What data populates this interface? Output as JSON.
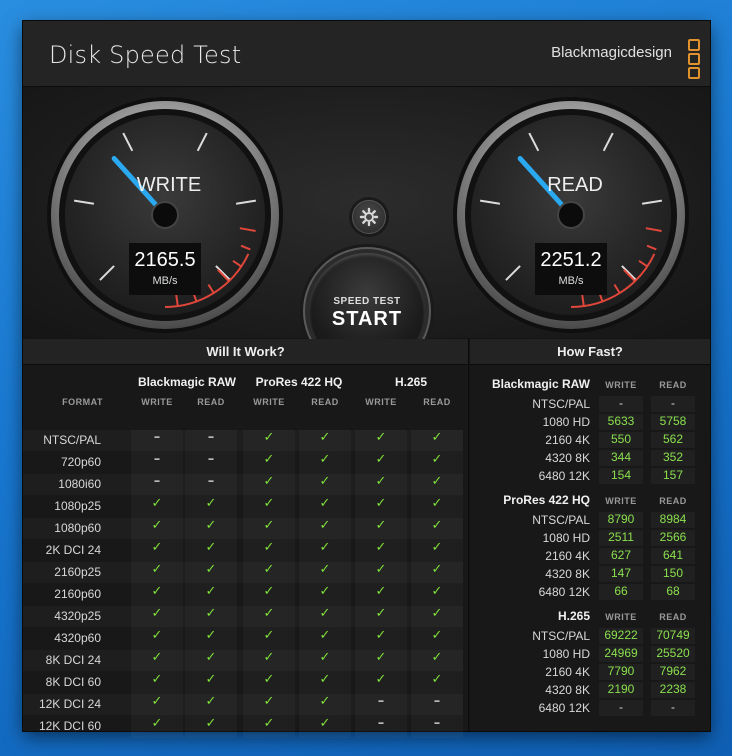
{
  "window": {
    "title": "Disk Speed Test",
    "brand": "Blackmagicdesign",
    "close_label": "✕"
  },
  "gauges": {
    "write": {
      "label": "WRITE",
      "value": "2165.5",
      "unit": "MB/s"
    },
    "read": {
      "label": "READ",
      "value": "2251.2",
      "unit": "MB/s"
    }
  },
  "start_button": {
    "line1": "SPEED TEST",
    "line2": "START"
  },
  "settings_icon": "gear-icon",
  "colors": {
    "accent_green": "#7fe03a",
    "logo_orange": "#e0922c",
    "needle": "#2aa8f0",
    "redline": "#e0473a"
  },
  "will_it_work": {
    "title": "Will It Work?",
    "format_label": "FORMAT",
    "groups": [
      {
        "name": "Blackmagic RAW",
        "write": "WRITE",
        "read": "READ"
      },
      {
        "name": "ProRes 422 HQ",
        "write": "WRITE",
        "read": "READ"
      },
      {
        "name": "H.265",
        "write": "WRITE",
        "read": "READ"
      }
    ],
    "yes_symbol": "✓",
    "no_symbol": "–",
    "rows": [
      {
        "format": "NTSC/PAL",
        "cells": [
          0,
          0,
          1,
          1,
          1,
          1
        ]
      },
      {
        "format": "720p60",
        "cells": [
          0,
          0,
          1,
          1,
          1,
          1
        ]
      },
      {
        "format": "1080i60",
        "cells": [
          0,
          0,
          1,
          1,
          1,
          1
        ]
      },
      {
        "format": "1080p25",
        "cells": [
          1,
          1,
          1,
          1,
          1,
          1
        ]
      },
      {
        "format": "1080p60",
        "cells": [
          1,
          1,
          1,
          1,
          1,
          1
        ]
      },
      {
        "format": "2K DCI 24",
        "cells": [
          1,
          1,
          1,
          1,
          1,
          1
        ]
      },
      {
        "format": "2160p25",
        "cells": [
          1,
          1,
          1,
          1,
          1,
          1
        ]
      },
      {
        "format": "2160p60",
        "cells": [
          1,
          1,
          1,
          1,
          1,
          1
        ]
      },
      {
        "format": "4320p25",
        "cells": [
          1,
          1,
          1,
          1,
          1,
          1
        ]
      },
      {
        "format": "4320p60",
        "cells": [
          1,
          1,
          1,
          1,
          1,
          1
        ]
      },
      {
        "format": "8K DCI 24",
        "cells": [
          1,
          1,
          1,
          1,
          1,
          1
        ]
      },
      {
        "format": "8K DCI 60",
        "cells": [
          1,
          1,
          1,
          1,
          1,
          1
        ]
      },
      {
        "format": "12K DCI 24",
        "cells": [
          1,
          1,
          1,
          1,
          0,
          0
        ]
      },
      {
        "format": "12K DCI 60",
        "cells": [
          1,
          1,
          1,
          1,
          0,
          0
        ]
      }
    ]
  },
  "how_fast": {
    "title": "How Fast?",
    "sections": [
      {
        "name": "Blackmagic RAW",
        "write": "WRITE",
        "read": "READ",
        "rows": [
          {
            "label": "NTSC/PAL",
            "write": "-",
            "read": "-"
          },
          {
            "label": "1080 HD",
            "write": "5633",
            "read": "5758"
          },
          {
            "label": "2160 4K",
            "write": "550",
            "read": "562"
          },
          {
            "label": "4320 8K",
            "write": "344",
            "read": "352"
          },
          {
            "label": "6480 12K",
            "write": "154",
            "read": "157"
          }
        ]
      },
      {
        "name": "ProRes 422 HQ",
        "write": "WRITE",
        "read": "READ",
        "rows": [
          {
            "label": "NTSC/PAL",
            "write": "8790",
            "read": "8984"
          },
          {
            "label": "1080 HD",
            "write": "2511",
            "read": "2566"
          },
          {
            "label": "2160 4K",
            "write": "627",
            "read": "641"
          },
          {
            "label": "4320 8K",
            "write": "147",
            "read": "150"
          },
          {
            "label": "6480 12K",
            "write": "66",
            "read": "68"
          }
        ]
      },
      {
        "name": "H.265",
        "write": "WRITE",
        "read": "READ",
        "rows": [
          {
            "label": "NTSC/PAL",
            "write": "69222",
            "read": "70749"
          },
          {
            "label": "1080 HD",
            "write": "24969",
            "read": "25520"
          },
          {
            "label": "2160 4K",
            "write": "7790",
            "read": "7962"
          },
          {
            "label": "4320 8K",
            "write": "2190",
            "read": "2238"
          },
          {
            "label": "6480 12K",
            "write": "-",
            "read": "-"
          }
        ]
      }
    ]
  }
}
